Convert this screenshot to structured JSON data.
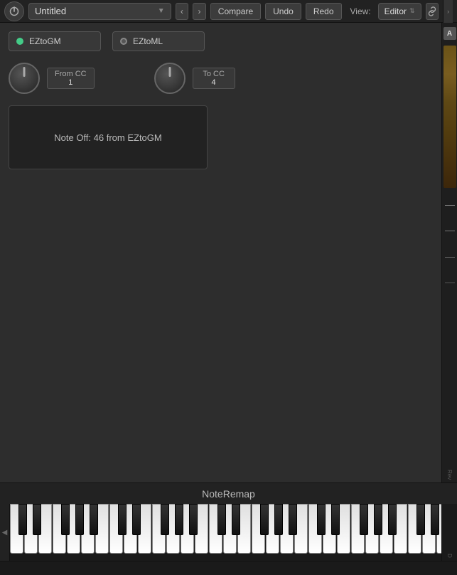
{
  "topbar": {
    "title": "Untitled",
    "title_arrow": "▼",
    "nav_back": "‹",
    "nav_forward": "›",
    "compare_label": "Compare",
    "undo_label": "Undo",
    "redo_label": "Redo",
    "view_label": "View:",
    "view_value": "Editor",
    "view_arrows": "⇅",
    "link_icon": "🔗",
    "right_toggle": "›"
  },
  "sidebar_right": {
    "a_label": "A"
  },
  "channels": [
    {
      "name": "EZtoGM",
      "active": true
    },
    {
      "name": "EZtoML",
      "active": false
    }
  ],
  "from_cc": {
    "label": "From CC",
    "value": "1"
  },
  "to_cc": {
    "label": "To CC",
    "value": "4"
  },
  "info_box": {
    "text": "Note Off: 46 from EZtoGM"
  },
  "piano_label": "NoteRemap",
  "bottom": {
    "d_label": "D",
    "rev_label": "Rev"
  }
}
